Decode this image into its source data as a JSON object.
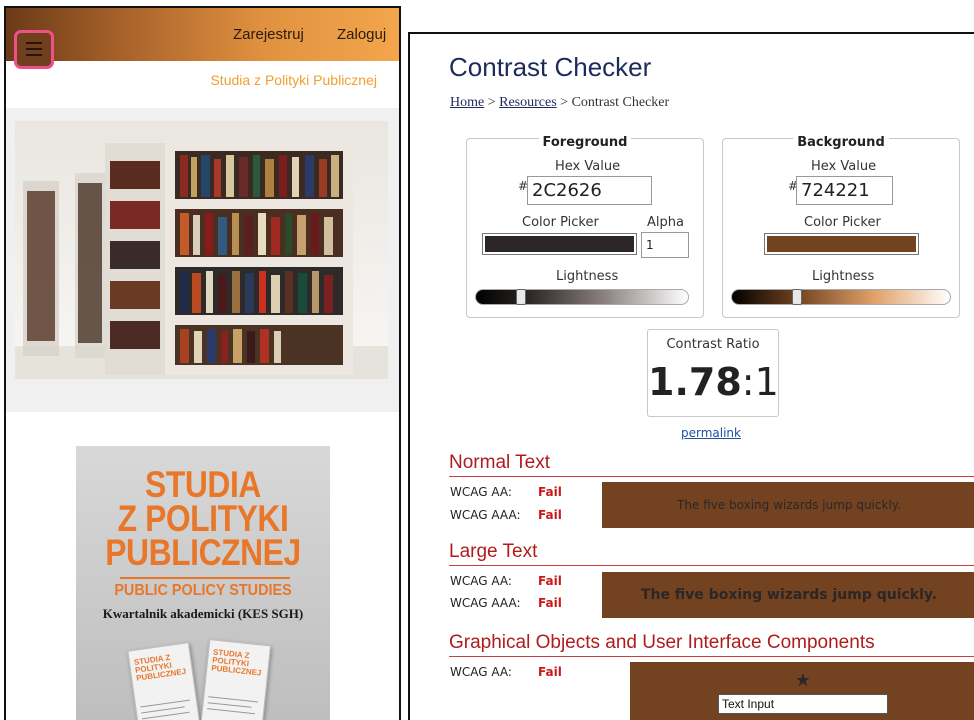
{
  "left": {
    "nav": {
      "register": "Zarejestruj",
      "login": "Zaloguj"
    },
    "site_subtitle": "Studia z Polityki Publicznej",
    "cover": {
      "title_lines": [
        "STUDIA",
        "Z POLITYKI",
        "PUBLICZNEJ"
      ],
      "subtitle_en": "PUBLIC POLICY STUDIES",
      "tagline": "Kwartalnik akademicki (KES SGH)",
      "mini_title": "STUDIA Z POLITYKI PUBLICZNEJ"
    }
  },
  "checker": {
    "title": "Contrast Checker",
    "breadcrumb": {
      "home": "Home",
      "sep1": " > ",
      "resources": "Resources",
      "sep2": " > ",
      "current": "Contrast Checker"
    },
    "foreground": {
      "legend": "Foreground",
      "hex_label": "Hex Value",
      "hash": "#",
      "hex": "2C2626",
      "picker_label": "Color Picker",
      "alpha_label": "Alpha",
      "alpha": "1",
      "lightness_label": "Lightness",
      "color": "#2c2626",
      "lightness": 0.2
    },
    "background": {
      "legend": "Background",
      "hex_label": "Hex Value",
      "hash": "#",
      "hex": "724221",
      "picker_label": "Color Picker",
      "lightness_label": "Lightness",
      "color": "#724221",
      "lightness": 0.29
    },
    "ratio": {
      "label": "Contrast Ratio",
      "value": "1.78",
      "suffix": ":1"
    },
    "permalink": "permalink",
    "normal_text": {
      "heading": "Normal Text",
      "aa_label": "WCAG AA:",
      "aa_result": "Fail",
      "aaa_label": "WCAG AAA:",
      "aaa_result": "Fail",
      "sample": "The five boxing wizards jump quickly."
    },
    "large_text": {
      "heading": "Large Text",
      "aa_label": "WCAG AA:",
      "aa_result": "Fail",
      "aaa_label": "WCAG AAA:",
      "aaa_result": "Fail",
      "sample": "The five boxing wizards jump quickly."
    },
    "graphical": {
      "heading": "Graphical Objects and User Interface Components",
      "aa_label": "WCAG AA:",
      "aa_result": "Fail",
      "star": "★",
      "input_text": "Text Input"
    }
  },
  "colors": {
    "fail": "#c81818",
    "heading": "#1f2a5c",
    "section": "#b01c1c",
    "accent_pink": "#f0508a"
  }
}
